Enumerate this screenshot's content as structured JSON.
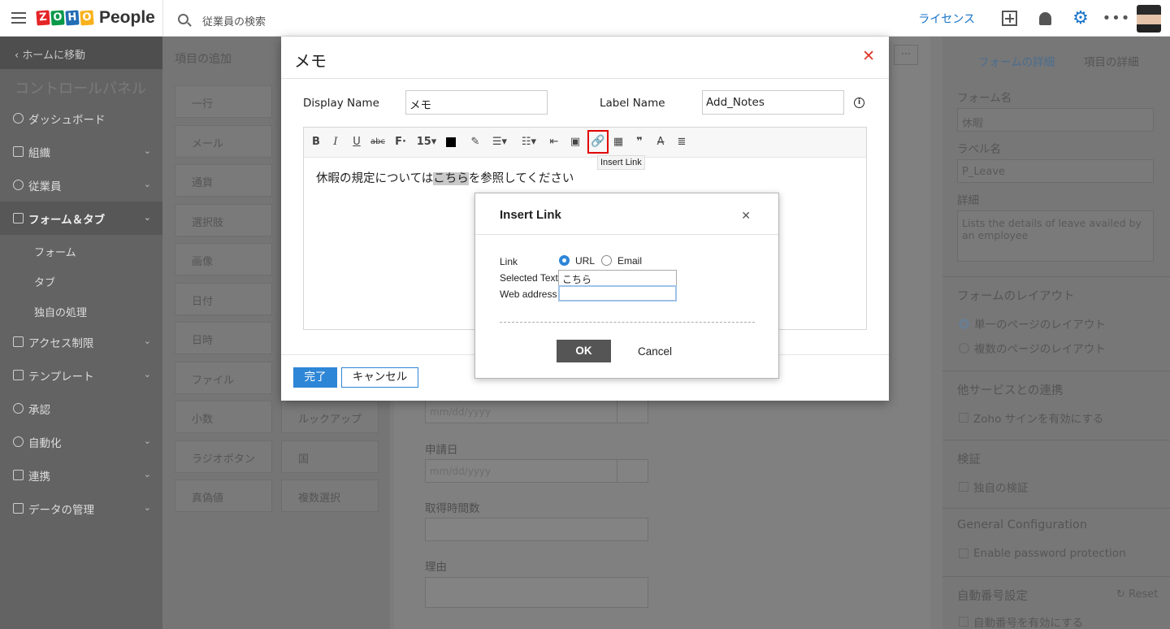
{
  "header": {
    "logo_letters": [
      "Z",
      "O",
      "H",
      "O"
    ],
    "logo_colors": [
      "#e42527",
      "#089949",
      "#226db4",
      "#f9b21d"
    ],
    "logo_text": "People",
    "search_placeholder": "従業員の検索",
    "license": "ライセンス"
  },
  "sidebar": {
    "back": "ホームに移動",
    "title": "コントロールパネル",
    "items": [
      {
        "label": "ダッシュボード"
      },
      {
        "label": "組織"
      },
      {
        "label": "従業員"
      },
      {
        "label": "フォーム＆タブ"
      },
      {
        "label": "アクセス制限"
      },
      {
        "label": "テンプレート"
      },
      {
        "label": "承認"
      },
      {
        "label": "自動化"
      },
      {
        "label": "連携"
      },
      {
        "label": "データの管理"
      }
    ],
    "subitems": [
      "フォーム",
      "タブ",
      "独自の処理"
    ]
  },
  "fields_panel": {
    "title": "項目の追加",
    "tiles": [
      "一行",
      "メール",
      "通貨",
      "選択肢",
      "画像",
      "日付",
      "日時",
      "ファイル",
      "小数",
      "ルックアップ",
      "ラジオボタン",
      "国",
      "真偽値",
      "複数選択"
    ]
  },
  "center_form": {
    "labels": [
      "申請日",
      "取得時間数",
      "理由"
    ],
    "date_placeholder": "mm/dd/yyyy",
    "more": "..."
  },
  "right_panel": {
    "tabs": [
      "フォームの詳細",
      "項目の詳細"
    ],
    "form_name_label": "フォーム名",
    "form_name_value": "休暇",
    "label_name_label": "ラベル名",
    "label_name_value": "P_Leave",
    "detail_label": "詳細",
    "detail_value": "Lists the details of leave availed by an employee",
    "layout_section": "フォームのレイアウト",
    "layout_single": "単一のページのレイアウト",
    "layout_multi": "複数のページのレイアウト",
    "integration_section": "他サービスとの連携",
    "zoho_sign": "Zoho サインを有効にする",
    "validation_section": "検証",
    "custom_validation": "独自の検証",
    "general_section": "General Configuration",
    "password_protection": "Enable password protection",
    "autonumber_section": "自動番号設定",
    "reset": "Reset",
    "autonumber_enable": "自動番号を有効にする"
  },
  "memo_dialog": {
    "title": "メモ",
    "display_name_label": "Display Name",
    "display_name_value": "メモ",
    "label_name_label": "Label Name",
    "label_name_value": "Add_Notes",
    "font_size": "15",
    "tooltip": "Insert Link",
    "body_before": "休暇の規定については",
    "body_selected": "こちら",
    "body_after": "を参照してください",
    "done_button": "完了",
    "cancel_button": "キャンセル"
  },
  "link_dialog": {
    "title": "Insert Link",
    "link_label": "Link",
    "opt_url": "URL",
    "opt_email": "Email",
    "selected_option": "URL",
    "selected_text_label": "Selected Text",
    "selected_text_value": "こちら",
    "web_address_label": "Web address",
    "web_address_value": "",
    "ok_button": "OK",
    "cancel_button": "Cancel"
  }
}
